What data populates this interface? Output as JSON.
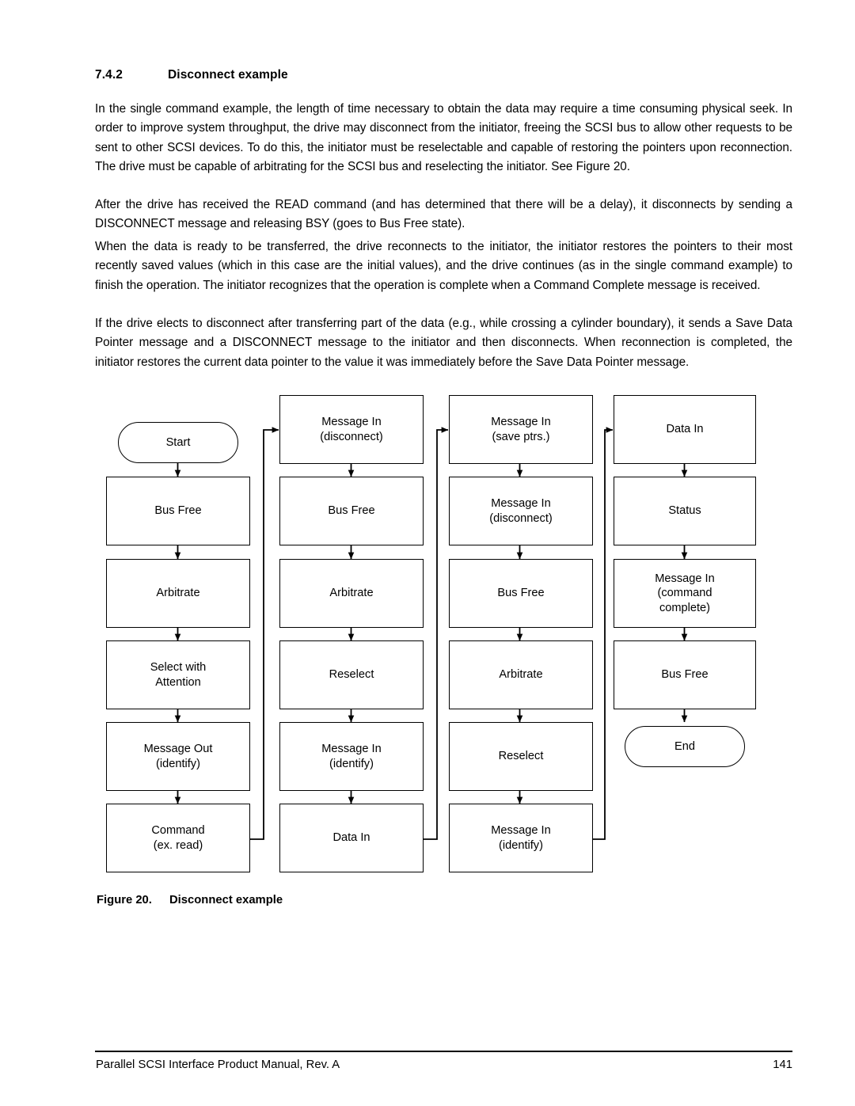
{
  "section": {
    "number": "7.4.2",
    "title": "Disconnect example"
  },
  "paragraphs": {
    "p1": "In the single command example, the length of time necessary to obtain the data may require a time consuming physical seek. In order to improve system throughput, the drive may disconnect from the initiator, freeing the SCSI bus to allow other requests to be sent to other SCSI devices. To do this, the initiator must be reselectable and capable of restoring the pointers upon reconnection. The drive must be capable of arbitrating for the SCSI bus and reselecting the initiator. See Figure 20.",
    "p2": "After the drive has received the READ command (and has determined that there will be a delay), it disconnects by sending a DISCONNECT message and releasing BSY (goes to Bus Free state).",
    "p3": "When the data is ready to be transferred, the drive reconnects to the initiator, the initiator restores the pointers to their most recently saved values (which in this case are the initial values), and the drive continues (as in the single command example) to finish the operation. The initiator recognizes that the operation is complete when a Command Complete message is received.",
    "p4": "If the drive elects to disconnect after transferring part of the data (e.g., while crossing a cylinder boundary), it sends a Save Data Pointer message and a DISCONNECT message to the initiator and then disconnects. When reconnection is completed, the initiator restores the current data pointer to the value it was immediately before the Save Data Pointer message."
  },
  "figure": {
    "label": "Figure 20.",
    "title": "Disconnect example",
    "columns": [
      {
        "nodes": [
          {
            "label": "Start",
            "shape": "terminator"
          },
          {
            "label": "Bus Free",
            "shape": "process"
          },
          {
            "label": "Arbitrate",
            "shape": "process"
          },
          {
            "label": "Select with\nAttention",
            "shape": "process"
          },
          {
            "label": "Message Out\n(identify)",
            "shape": "process"
          },
          {
            "label": "Command\n(ex. read)",
            "shape": "process"
          }
        ]
      },
      {
        "nodes": [
          {
            "label": "Message In\n(disconnect)",
            "shape": "process"
          },
          {
            "label": "Bus Free",
            "shape": "process"
          },
          {
            "label": "Arbitrate",
            "shape": "process"
          },
          {
            "label": "Reselect",
            "shape": "process"
          },
          {
            "label": "Message In\n(identify)",
            "shape": "process"
          },
          {
            "label": "Data In",
            "shape": "process"
          }
        ]
      },
      {
        "nodes": [
          {
            "label": "Message In\n(save ptrs.)",
            "shape": "process"
          },
          {
            "label": "Message In\n(disconnect)",
            "shape": "process"
          },
          {
            "label": "Bus Free",
            "shape": "process"
          },
          {
            "label": "Arbitrate",
            "shape": "process"
          },
          {
            "label": "Reselect",
            "shape": "process"
          },
          {
            "label": "Message In\n(identify)",
            "shape": "process"
          }
        ]
      },
      {
        "nodes": [
          {
            "label": "Data In",
            "shape": "process"
          },
          {
            "label": "Status",
            "shape": "process"
          },
          {
            "label": "Message In\n(command\ncomplete)",
            "shape": "process"
          },
          {
            "label": "Bus Free",
            "shape": "process"
          },
          {
            "label": "End",
            "shape": "terminator"
          }
        ]
      }
    ]
  },
  "footer": {
    "document_title": "Parallel SCSI Interface Product Manual, Rev. A",
    "page_number": "141"
  }
}
